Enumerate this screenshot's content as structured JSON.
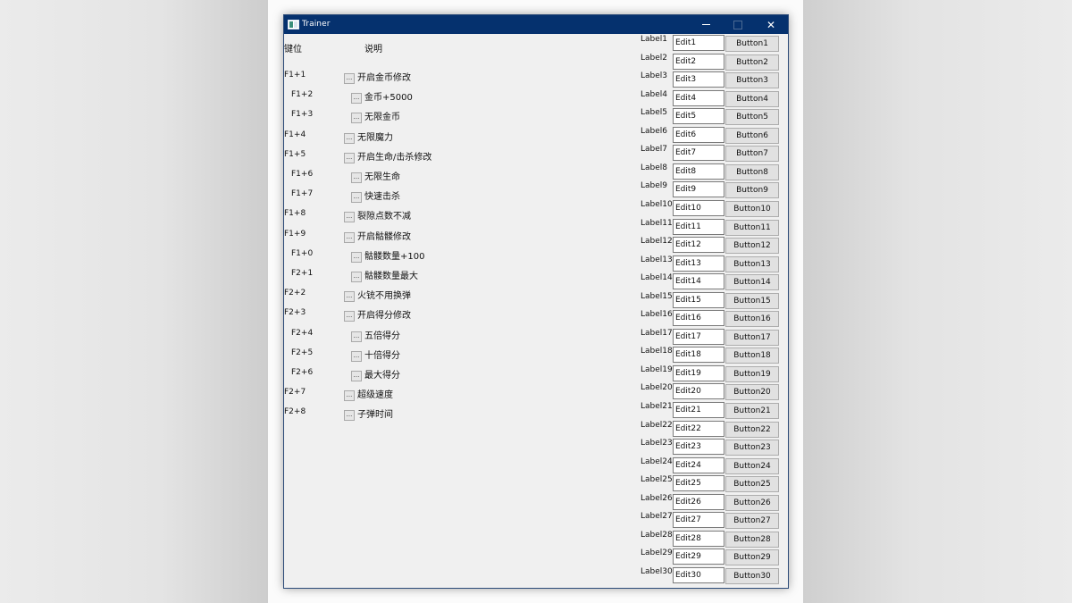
{
  "window": {
    "title": "Trainer",
    "controls": {
      "minimize": "minimize",
      "maximize": "maximize",
      "close": "✕"
    }
  },
  "headers": {
    "key": "键位",
    "description": "说明"
  },
  "hotkeys": [
    {
      "key": "F1+1",
      "label": "开启金币修改",
      "indent": 0
    },
    {
      "key": "F1+2",
      "label": "金币+5000",
      "indent": 1
    },
    {
      "key": "F1+3",
      "label": "无限金币",
      "indent": 1
    },
    {
      "key": "F1+4",
      "label": "无限魔力",
      "indent": 0
    },
    {
      "key": "F1+5",
      "label": "开启生命/击杀修改",
      "indent": 0
    },
    {
      "key": "F1+6",
      "label": "无限生命",
      "indent": 1
    },
    {
      "key": "F1+7",
      "label": "快速击杀",
      "indent": 1
    },
    {
      "key": "F1+8",
      "label": "裂隙点数不减",
      "indent": 0
    },
    {
      "key": "F1+9",
      "label": "开启骷髅修改",
      "indent": 0
    },
    {
      "key": "F1+0",
      "label": "骷髅数量+100",
      "indent": 1
    },
    {
      "key": "F2+1",
      "label": "骷髅数量最大",
      "indent": 1
    },
    {
      "key": "F2+2",
      "label": "火铳不用换弹",
      "indent": 0
    },
    {
      "key": "F2+3",
      "label": "开启得分修改",
      "indent": 0
    },
    {
      "key": "F2+4",
      "label": "五倍得分",
      "indent": 1
    },
    {
      "key": "F2+5",
      "label": "十倍得分",
      "indent": 1
    },
    {
      "key": "F2+6",
      "label": "最大得分",
      "indent": 1
    },
    {
      "key": "F2+7",
      "label": "超级速度",
      "indent": 0
    },
    {
      "key": "F2+8",
      "label": "子弹时间",
      "indent": 0
    }
  ],
  "checkbox_glyph": "...",
  "fields": [
    {
      "label": "Label1",
      "edit": "Edit1",
      "button": "Button1"
    },
    {
      "label": "Label2",
      "edit": "Edit2",
      "button": "Button2"
    },
    {
      "label": "Label3",
      "edit": "Edit3",
      "button": "Button3"
    },
    {
      "label": "Label4",
      "edit": "Edit4",
      "button": "Button4"
    },
    {
      "label": "Label5",
      "edit": "Edit5",
      "button": "Button5"
    },
    {
      "label": "Label6",
      "edit": "Edit6",
      "button": "Button6"
    },
    {
      "label": "Label7",
      "edit": "Edit7",
      "button": "Button7"
    },
    {
      "label": "Label8",
      "edit": "Edit8",
      "button": "Button8"
    },
    {
      "label": "Label9",
      "edit": "Edit9",
      "button": "Button9"
    },
    {
      "label": "Label10",
      "edit": "Edit10",
      "button": "Button10"
    },
    {
      "label": "Label11",
      "edit": "Edit11",
      "button": "Button11"
    },
    {
      "label": "Label12",
      "edit": "Edit12",
      "button": "Button12"
    },
    {
      "label": "Label13",
      "edit": "Edit13",
      "button": "Button13"
    },
    {
      "label": "Label14",
      "edit": "Edit14",
      "button": "Button14"
    },
    {
      "label": "Label15",
      "edit": "Edit15",
      "button": "Button15"
    },
    {
      "label": "Label16",
      "edit": "Edit16",
      "button": "Button16"
    },
    {
      "label": "Label17",
      "edit": "Edit17",
      "button": "Button17"
    },
    {
      "label": "Label18",
      "edit": "Edit18",
      "button": "Button18"
    },
    {
      "label": "Label19",
      "edit": "Edit19",
      "button": "Button19"
    },
    {
      "label": "Label20",
      "edit": "Edit20",
      "button": "Button20"
    },
    {
      "label": "Label21",
      "edit": "Edit21",
      "button": "Button21"
    },
    {
      "label": "Label22",
      "edit": "Edit22",
      "button": "Button22"
    },
    {
      "label": "Label23",
      "edit": "Edit23",
      "button": "Button23"
    },
    {
      "label": "Label24",
      "edit": "Edit24",
      "button": "Button24"
    },
    {
      "label": "Label25",
      "edit": "Edit25",
      "button": "Button25"
    },
    {
      "label": "Label26",
      "edit": "Edit26",
      "button": "Button26"
    },
    {
      "label": "Label27",
      "edit": "Edit27",
      "button": "Button27"
    },
    {
      "label": "Label28",
      "edit": "Edit28",
      "button": "Button28"
    },
    {
      "label": "Label29",
      "edit": "Edit29",
      "button": "Button29"
    },
    {
      "label": "Label30",
      "edit": "Edit30",
      "button": "Button30"
    }
  ],
  "colors": {
    "titlebar": "#05316e",
    "client": "#f0f0f0",
    "button": "#e1e1e1"
  }
}
